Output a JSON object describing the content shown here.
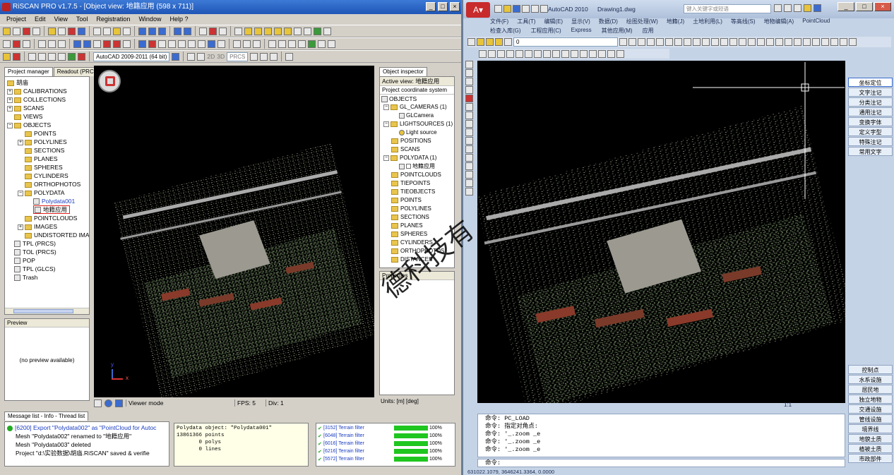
{
  "riscan": {
    "title": "RiSCAN PRO v1.7.5 - [Object view: 地籍应用 (598 x 711)]",
    "menu": [
      "Project",
      "Edit",
      "View",
      "Tool",
      "Registration",
      "Window",
      "Help ?"
    ],
    "version_combo": "AutoCAD 2009-2011 (64 bit)",
    "coord_combo": "PRCS",
    "btn_2d": "2D",
    "btn_3d": "3D",
    "tabs": {
      "project_manager": "Project manager",
      "readout": "Readout (PRCS)"
    },
    "tree": {
      "root": "胡庙",
      "items": [
        "CALIBRATIONS",
        "COLLECTIONS",
        "SCANS",
        "VIEWS",
        "OBJECTS",
        "POINTS",
        "POLYLINES",
        "SECTIONS",
        "PLANES",
        "SPHERES",
        "CYLINDERS",
        "ORTHOPHOTOS",
        "POLYDATA",
        "Polydata001",
        "地籍应用",
        "POINTCLOUDS",
        "IMAGES",
        "UNDISTORTED IMA",
        "TPL (PRCS)",
        "TOL (PRCS)",
        "POP",
        "TPL (GLCS)",
        "Trash"
      ]
    },
    "preview": {
      "title": "Preview",
      "text": "(no preview available)"
    },
    "viewer": {
      "mode": "Viewer mode",
      "fps": "FPS: 5",
      "div": "Div: 1"
    },
    "inspector": {
      "tab": "Object inspector",
      "active_view": "Active view: 地籍应用",
      "coord_system": "Project coordinate system",
      "items": [
        "OBJECTS",
        "GL_CAMERAS (1)",
        "GLCamera",
        "LIGHTSOURCES (1)",
        "Light source",
        "POSITIONS",
        "SCANS",
        "POLYDATA (1)",
        "地籍应用",
        "POINTCLOUDS",
        "TIEPOINTS",
        "TIEOBJECTS",
        "POINTS",
        "POLYLINES",
        "SECTIONS",
        "PLANES",
        "SPHERES",
        "CYLINDERS",
        "ORTHOPHOTOS",
        "DISTANCES"
      ],
      "properties": "Properties",
      "units": "Units: [m] [deg]"
    },
    "messages": {
      "tab": "Message list - Info - Thread list",
      "lines": [
        "[6200] Export \"Polydata002\" as \"PointCloud for Autoc",
        "Mesh \"Polydata002\" renamed to \"地籍应用\"",
        "Mesh \"Polydata003\" deleted",
        "Project \"d:\\实验数据\\胡庙.RiSCAN\" saved & verifie"
      ]
    },
    "info": {
      "lines": [
        "Polydata object: \"Polydata001\"",
        "",
        "13861366 points",
        "       0 polys",
        "       0 lines"
      ]
    },
    "threads": [
      {
        "id": "[3152] Terrain filter",
        "pct": "100%"
      },
      {
        "id": "[6048] Terrain filter",
        "pct": "100%"
      },
      {
        "id": "[6016] Terrain filter",
        "pct": "100%"
      },
      {
        "id": "[6216] Terrain filter",
        "pct": "100%"
      },
      {
        "id": "[5572] Terrain filter",
        "pct": "100%"
      }
    ],
    "axis": {
      "x": "x",
      "y": "y"
    }
  },
  "watermark": "德科技有",
  "acad": {
    "title": "AutoCAD 2010",
    "doc": "Drawing1.dwg",
    "search_placeholder": "键入关键字或短语",
    "menu1": [
      "文件(F)",
      "工具(T)",
      "编辑(E)",
      "显示(V)",
      "数据(D)",
      "绘图处理(W)",
      "地籍(J)",
      "土地利用(L)",
      "等高线(S)",
      "地物编辑(A)",
      "PointCloud"
    ],
    "menu2": [
      "检查入库(G)",
      "工程应用(C)",
      "Express",
      "其他应用(M)",
      "应用"
    ],
    "layer_combo": "0",
    "right_top": [
      "坐标定位",
      "文字注记",
      "分类注记",
      "通用注记",
      "变换字体",
      "定义字型",
      "特殊注记",
      "常用文字"
    ],
    "right_bottom": [
      "控制点",
      "水系设施",
      "居民地",
      "独立地物",
      "交通设施",
      "管线设施",
      "境界线",
      "地貌土质",
      "植被土质",
      "市政部件"
    ],
    "scale": "1:1",
    "command_lines": [
      "命令: PC_LOAD",
      "命令: 指定对角点:",
      "命令: '_.zoom _e",
      "命令: '_.zoom _e",
      "命令: '_.zoom _e"
    ],
    "prompt": "命令:",
    "coords": "631022.1079, 3646241.3364, 0.0000"
  },
  "colors": {
    "riscan_title": "#1f55b5",
    "acad_bg": "#c5d3e6",
    "progress": "#1fc61f"
  }
}
